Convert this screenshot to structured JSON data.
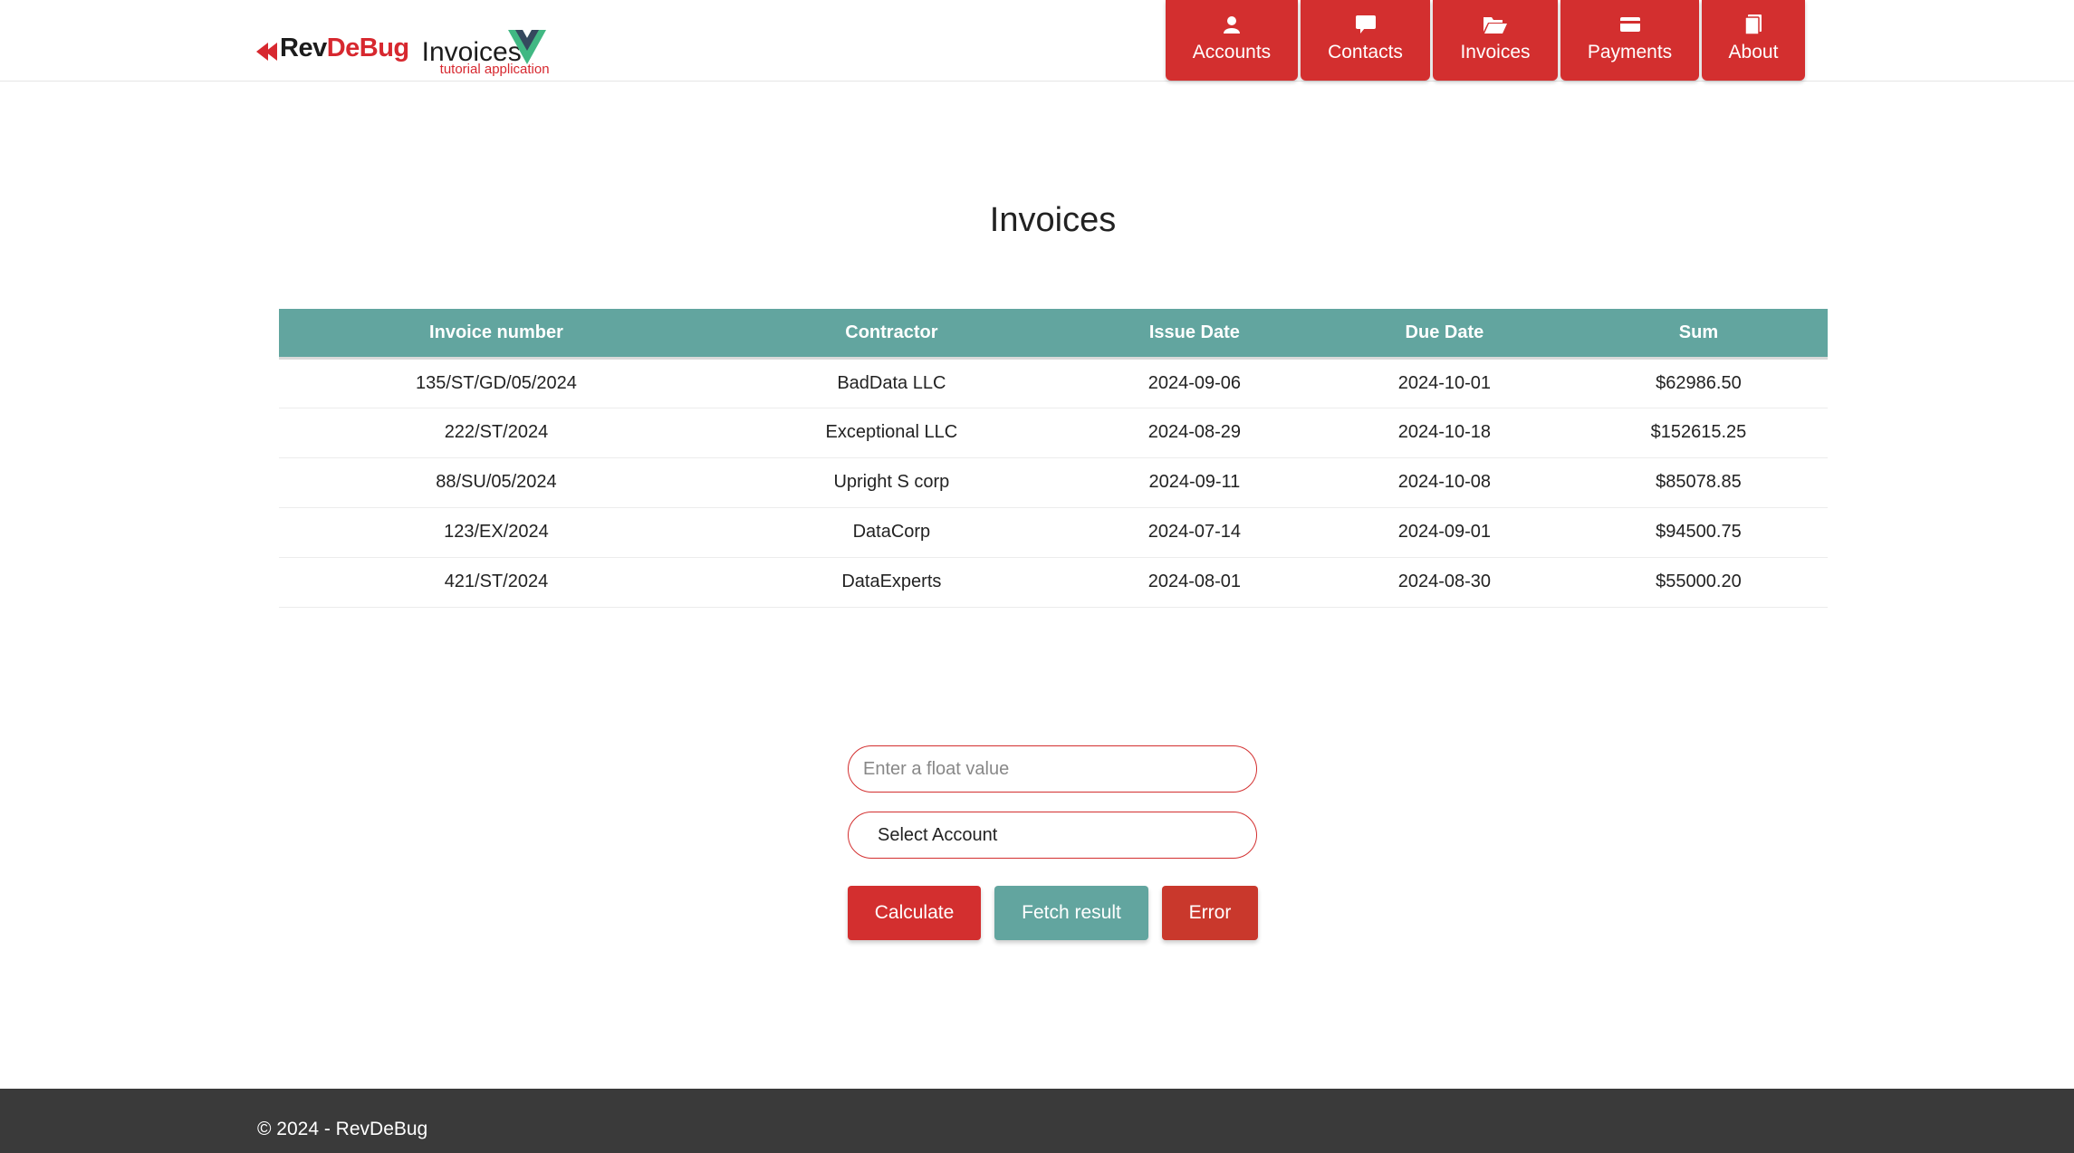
{
  "header": {
    "logo_brand_left": "Rev",
    "logo_brand_right": "DeBug",
    "logo_app_title": "Invoices",
    "logo_app_subtitle": "tutorial application",
    "brand_color": "#d32f2f",
    "nav": [
      {
        "label": "Accounts",
        "icon": "user-icon"
      },
      {
        "label": "Contacts",
        "icon": "comment-icon"
      },
      {
        "label": "Invoices",
        "icon": "folder-open-icon"
      },
      {
        "label": "Payments",
        "icon": "credit-card-icon"
      },
      {
        "label": "About",
        "icon": "book-icon"
      }
    ]
  },
  "main": {
    "title": "Invoices",
    "table": {
      "header_color": "#62a59f",
      "columns": [
        "Invoice number",
        "Contractor",
        "Issue Date",
        "Due Date",
        "Sum"
      ],
      "rows": [
        [
          "135/ST/GD/05/2024",
          "BadData LLC",
          "2024-09-06",
          "2024-10-01",
          "$62986.50"
        ],
        [
          "222/ST/2024",
          "Exceptional LLC",
          "2024-08-29",
          "2024-10-18",
          "$152615.25"
        ],
        [
          "88/SU/05/2024",
          "Upright S corp",
          "2024-09-11",
          "2024-10-08",
          "$85078.85"
        ],
        [
          "123/EX/2024",
          "DataCorp",
          "2024-07-14",
          "2024-09-01",
          "$94500.75"
        ],
        [
          "421/ST/2024",
          "DataExperts",
          "2024-08-01",
          "2024-08-30",
          "$55000.20"
        ]
      ]
    },
    "form": {
      "float_input_placeholder": "Enter a float value",
      "float_input_value": "",
      "account_select_value": "Select Account",
      "calculate_label": "Calculate",
      "fetch_label": "Fetch result",
      "error_label": "Error"
    }
  },
  "footer": {
    "text": "© 2024 - RevDeBug"
  }
}
